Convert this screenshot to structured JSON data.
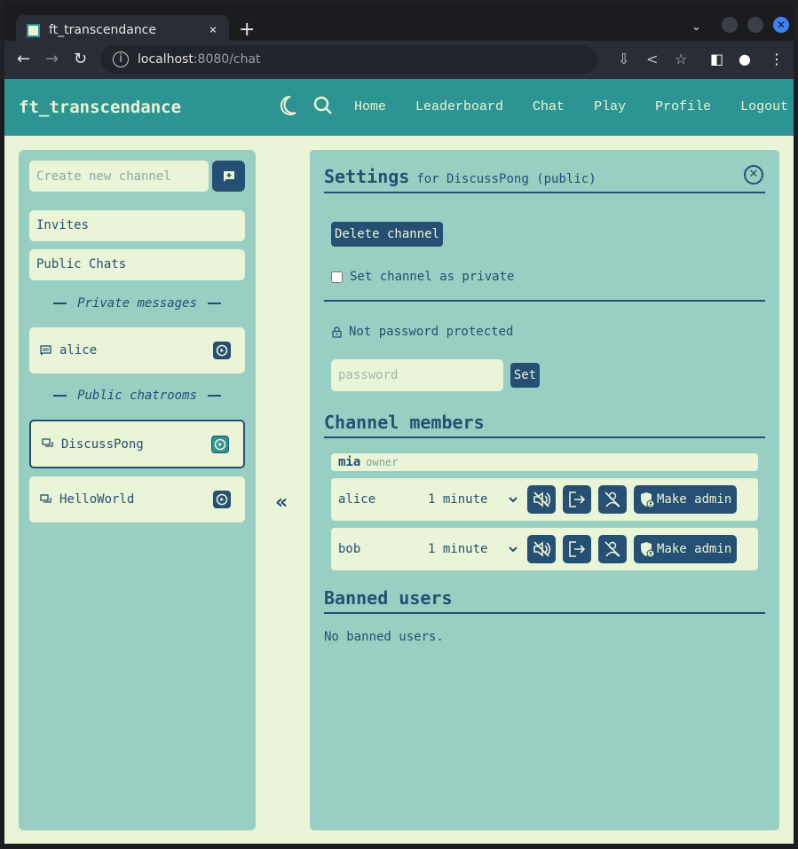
{
  "browser": {
    "tab_title": "ft_transcendance",
    "tab_close": "×",
    "new_tab": "+",
    "url_host": "localhost",
    "url_rest": ":8080/chat",
    "window_close": "✕"
  },
  "app": {
    "brand": "ft_transcendance",
    "nav": [
      "Home",
      "Leaderboard",
      "Chat",
      "Play",
      "Profile",
      "Logout"
    ]
  },
  "sidebar": {
    "new_channel_placeholder": "Create new channel",
    "invites": "Invites",
    "public_chats": "Public Chats",
    "private_heading": "Private messages",
    "public_heading": "Public chatrooms",
    "private_chats": [
      {
        "name": "alice",
        "icon": "message-icon"
      }
    ],
    "public_chatrooms": [
      {
        "name": "DiscussPong",
        "icon": "chatrooms-icon",
        "active": true
      },
      {
        "name": "HelloWorld",
        "icon": "chatrooms-icon",
        "active": false
      }
    ],
    "collapse_label": "«"
  },
  "settings": {
    "title": "Settings",
    "subtitle": "for DiscussPong (public)",
    "delete_label": "Delete channel",
    "private_label": "Set channel as private",
    "private_checked": false,
    "password_status": "Not password protected",
    "password_placeholder": "password",
    "set_label": "Set",
    "members_heading": "Channel members",
    "owner": {
      "name": "mia",
      "role": "owner"
    },
    "members": [
      {
        "name": "alice",
        "mute_duration": "1 minute",
        "make_admin_label": "Make admin"
      },
      {
        "name": "bob",
        "mute_duration": "1 minute",
        "make_admin_label": "Make admin"
      }
    ],
    "banned_heading": "Banned users",
    "banned_empty": "No banned users."
  },
  "colors": {
    "primary": "#2c9492",
    "dark": "#254f73",
    "panel": "#98cfc2",
    "background": "#eaf4d6"
  }
}
